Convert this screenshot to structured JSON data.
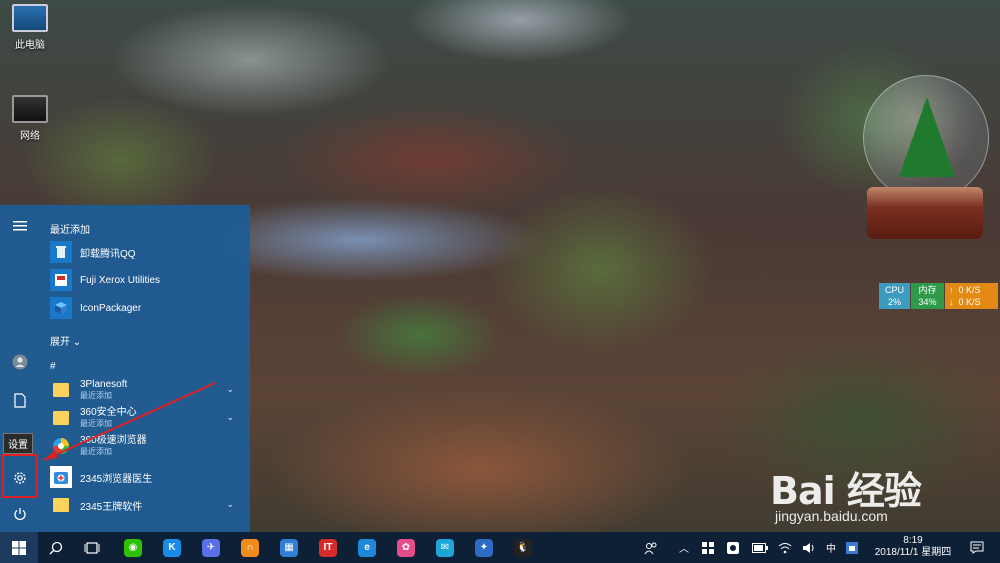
{
  "desktop": {
    "icons": [
      {
        "label": "此电脑",
        "icon": "computer-icon"
      },
      {
        "label": "网络",
        "icon": "network-icon"
      }
    ],
    "monitor": {
      "cpu_label": "CPU",
      "cpu_value": "2%",
      "mem_label": "内存",
      "mem_value": "34%",
      "up_rate": "0 K/S",
      "down_rate": "0 K/S",
      "colors": {
        "cpu": "#3c9bbf",
        "mem": "#2f9a4a",
        "net": "#e28a14"
      }
    }
  },
  "start_menu": {
    "tooltip": "设置",
    "recent_header": "最近添加",
    "recent_apps": [
      {
        "label": "卸载腾讯QQ",
        "icon": "recycle-bin-icon"
      },
      {
        "label": "Fuji Xerox Utilities",
        "icon": "fuji-xerox-icon"
      },
      {
        "label": "IconPackager",
        "icon": "iconpackager-icon"
      }
    ],
    "expand_label": "展开",
    "group_header": "#",
    "apps": [
      {
        "label": "3Planesoft",
        "sub": "最近添加",
        "icon": "folder-icon",
        "expandable": true
      },
      {
        "label": "360安全中心",
        "sub": "最近添加",
        "icon": "folder-icon",
        "expandable": true
      },
      {
        "label": "360极速浏览器",
        "sub": "最近添加",
        "icon": "360-browser-icon",
        "expandable": false
      },
      {
        "label": "2345浏览器医生",
        "sub": "",
        "icon": "browser-doctor-icon",
        "expandable": false
      },
      {
        "label": "2345王牌软件",
        "sub": "",
        "icon": "folder-icon",
        "expandable": true
      }
    ],
    "accent": "#1e5c96",
    "highlight_color": "#e02020"
  },
  "taskbar": {
    "pinned_apps": [
      {
        "name": "wechat",
        "icon": "wechat-icon",
        "color": "#2dc100",
        "glyph": "◉"
      },
      {
        "name": "kugou",
        "icon": "kugou-icon",
        "color": "#1a8ce8",
        "glyph": "K"
      },
      {
        "name": "feishu",
        "icon": "plane-icon",
        "color": "#5a6ee8",
        "glyph": "✈"
      },
      {
        "name": "app-orange",
        "icon": "orange-ring-icon",
        "color": "#f28c1c",
        "glyph": "∩"
      },
      {
        "name": "app-blue-doc",
        "icon": "blue-doc-icon",
        "color": "#2f7fd6",
        "glyph": "▦"
      },
      {
        "name": "ithome",
        "icon": "it-icon",
        "color": "#d62b2b",
        "glyph": "IT"
      },
      {
        "name": "ie",
        "icon": "ie-icon",
        "color": "#1e88d8",
        "glyph": "e"
      },
      {
        "name": "picasa",
        "icon": "color-wheel-icon",
        "color": "#e44c8a",
        "glyph": "✿"
      },
      {
        "name": "app-cyan",
        "icon": "cyan-app-icon",
        "color": "#1fa6d8",
        "glyph": "✉"
      },
      {
        "name": "app-blue-tools",
        "icon": "tools-icon",
        "color": "#2b6bc4",
        "glyph": "✦"
      },
      {
        "name": "qq",
        "icon": "qq-icon",
        "color": "#222222",
        "glyph": "🐧"
      }
    ],
    "tray_ime": "中",
    "time": "8:19",
    "date": "2018/11/1 星期四"
  },
  "watermark": {
    "logo": "Bai 经验",
    "url": "jingyan.baidu.com"
  }
}
